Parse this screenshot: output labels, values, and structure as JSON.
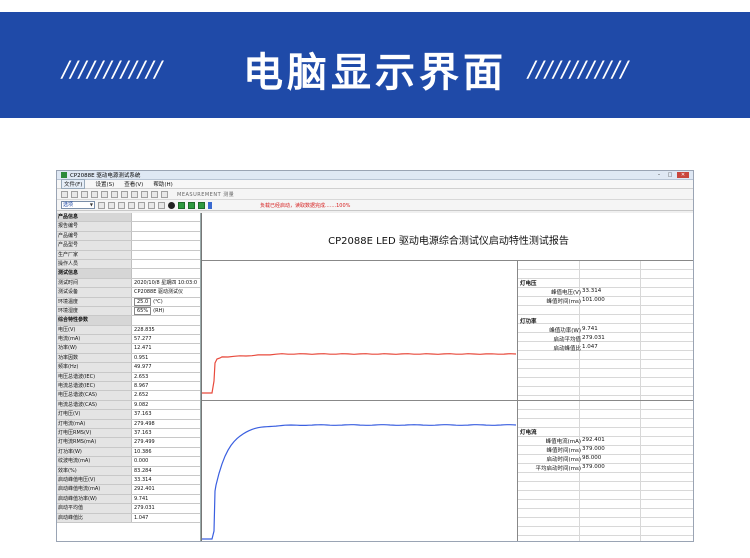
{
  "banner": {
    "title": "电脑显示界面",
    "deco_left": "////////////",
    "deco_right": "////////////"
  },
  "window": {
    "title": "CP2088E 驱动电源测试系统",
    "menu": [
      "文件(F)",
      "设置(S)",
      "查看(V)",
      "帮助(H)"
    ],
    "toolbar_text": "MEASUREMENT 测量",
    "select_value": "选项",
    "status_message": "负载已经启动，读取数据完成.......100%"
  },
  "left_panel": {
    "rows": [
      {
        "label": "产品信息",
        "value": "",
        "section": true
      },
      {
        "label": "报告编号",
        "value": ""
      },
      {
        "label": "产品编号",
        "value": ""
      },
      {
        "label": "产品型号",
        "value": ""
      },
      {
        "label": "生产厂家",
        "value": ""
      },
      {
        "label": "操作人员",
        "value": ""
      },
      {
        "label": "测试信息",
        "value": "",
        "section": true
      },
      {
        "label": "测试时间",
        "value": "2020/10/8 星期四 10:03:0"
      },
      {
        "label": "测试设备",
        "value": "CP2088E 驱动测试仪"
      },
      {
        "label": "环境温度",
        "value": "25.0",
        "unit": "(℃)"
      },
      {
        "label": "环境湿度",
        "value": "65%",
        "unit": "(RH)"
      },
      {
        "label": "综合特性参数",
        "value": "",
        "section": true
      },
      {
        "label": "电压(V)",
        "value": "228.835"
      },
      {
        "label": "电流(mA)",
        "value": "57.277"
      },
      {
        "label": "功率(W)",
        "value": "12.471"
      },
      {
        "label": "功率因数",
        "value": "0.951"
      },
      {
        "label": "频率(Hz)",
        "value": "49.977"
      },
      {
        "label": "电压总谐波(IEC)",
        "value": "2.653"
      },
      {
        "label": "电流总谐波(IEC)",
        "value": "8.967"
      },
      {
        "label": "电压总谐波(CAS)",
        "value": "2.652"
      },
      {
        "label": "电流总谐波(CAS)",
        "value": "9.082"
      },
      {
        "label": "灯电压(V)",
        "value": "37.163"
      },
      {
        "label": "灯电流(mA)",
        "value": "279.498"
      },
      {
        "label": "灯电压RMS(V)",
        "value": "37.163"
      },
      {
        "label": "灯电流RMS(mA)",
        "value": "279.499"
      },
      {
        "label": "灯功率(W)",
        "value": "10.386"
      },
      {
        "label": "纹波电流(mA)",
        "value": "0.000"
      },
      {
        "label": "效率(%)",
        "value": "83.284"
      },
      {
        "label": "启动峰值电压(V)",
        "value": "33.314"
      },
      {
        "label": "启动峰值电流(mA)",
        "value": "292.401"
      },
      {
        "label": "启动峰值功率(W)",
        "value": "9.741"
      },
      {
        "label": "启动平均值",
        "value": "279.031"
      },
      {
        "label": "启动峰值比",
        "value": "1.047"
      }
    ]
  },
  "report": {
    "title": "CP2088E LED 驱动电源综合测试仪启动特性测试报告",
    "voltage_section": {
      "heading": "灯电压",
      "rows": [
        {
          "key": "峰值电压(V)",
          "value": "33.314"
        },
        {
          "key": "峰值时间(ms)",
          "value": "101.000"
        }
      ]
    },
    "power_section": {
      "heading": "灯功率",
      "rows": [
        {
          "key": "峰值功率(W)",
          "value": "9.741"
        },
        {
          "key": "启动平均值",
          "value": "279.031"
        },
        {
          "key": "启动峰值比",
          "value": "1.047"
        }
      ]
    },
    "current_section": {
      "heading": "灯电流",
      "rows": [
        {
          "key": "峰值电流(mA)",
          "value": "292.401"
        },
        {
          "key": "峰值时间(ms)",
          "value": "379.000"
        },
        {
          "key": "启动时间(ms)",
          "value": "98.000"
        },
        {
          "key": "平均启动时间(ms)",
          "value": "379.000"
        }
      ]
    }
  },
  "colors": {
    "banner": "#1f4aa8",
    "voltage_curve": "#e84a3c",
    "current_curve": "#3a5fe0"
  }
}
